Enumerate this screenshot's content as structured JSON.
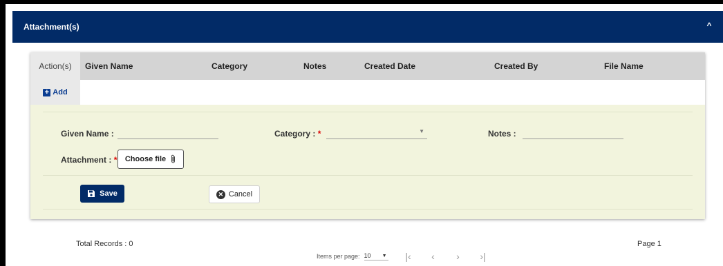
{
  "panel": {
    "title": "Attachment(s)",
    "collapse_glyph": "^"
  },
  "grid": {
    "columns": [
      "Action(s)",
      "Given Name",
      "Category",
      "Notes",
      "Created Date",
      "Created By",
      "File Name"
    ],
    "add_label": "Add"
  },
  "form": {
    "given_name_label": "Given Name :",
    "given_name_value": "",
    "category_label": "Category :",
    "category_value": "",
    "notes_label": "Notes :",
    "notes_value": "",
    "attachment_label": "Attachment :",
    "required_mark": "*",
    "choose_file_label": "Choose file",
    "save_label": "Save",
    "cancel_label": "Cancel"
  },
  "footer": {
    "total_records": "Total Records : 0",
    "items_per_page_label": "Items per page:",
    "items_per_page_value": "10",
    "page_label": "Page 1"
  },
  "icons": {
    "collapse": "chevron-up-icon",
    "add": "plus-square-icon",
    "attachment": "paperclip-icon",
    "save": "floppy-disk-icon",
    "cancel": "close-circle-icon",
    "dropdown": "caret-down-icon",
    "first_page": "first-page-icon",
    "prev_page": "chevron-left-icon",
    "next_page": "chevron-right-icon",
    "last_page": "last-page-icon"
  },
  "colors": {
    "header_bg": "#022b67",
    "form_bg": "#f2f4dd",
    "grid_header_bg": "#d4d4d4",
    "accent": "#0b3d91",
    "required": "#dd0000"
  }
}
